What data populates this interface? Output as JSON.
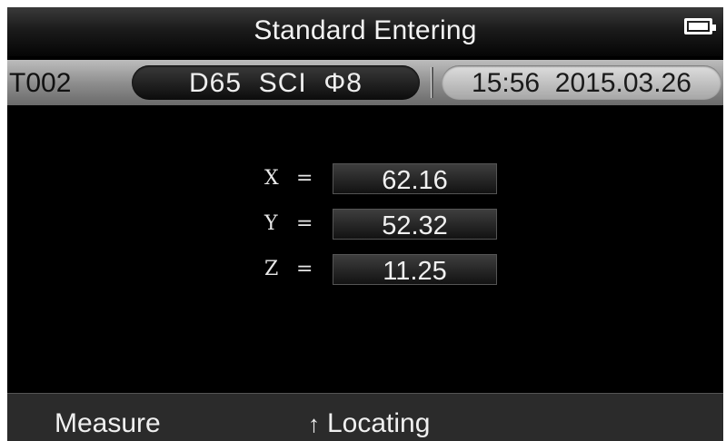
{
  "header": {
    "title": "Standard Entering",
    "battery_icon": "battery-full-icon"
  },
  "status": {
    "test_id": "T002",
    "conditions": "D65  SCI  Φ8",
    "datetime": "15:56  2015.03.26"
  },
  "values": [
    {
      "label": "X",
      "equals": "=",
      "value": "62.16"
    },
    {
      "label": "Y",
      "equals": "=",
      "value": "52.32"
    },
    {
      "label": "Z",
      "equals": "=",
      "value": "11.25"
    }
  ],
  "softkeys": {
    "left_label": "Measure",
    "middle_icon": "up-arrow-icon",
    "middle_label": "Locating"
  },
  "colors": {
    "background": "#000000",
    "text": "#f0f0f0",
    "status_bar": "#9a9a9a"
  }
}
